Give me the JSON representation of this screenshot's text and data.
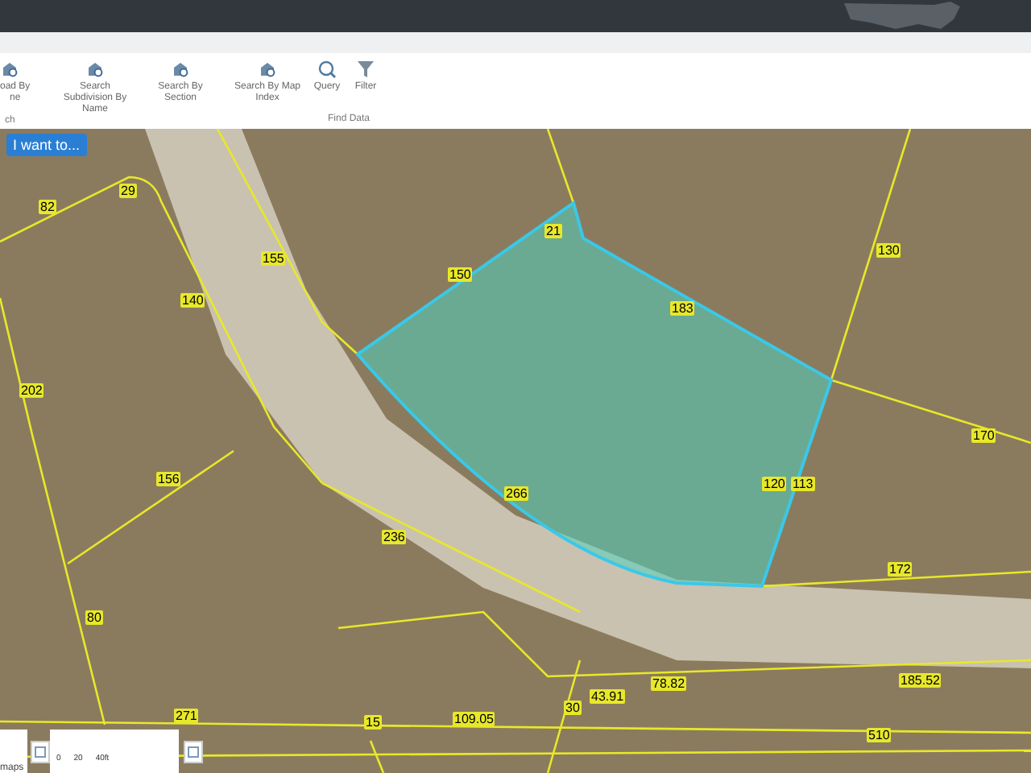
{
  "toolbar": {
    "groups": [
      {
        "label": "ch",
        "items": [
          {
            "kind": "search",
            "lines": [
              "oad By",
              "ne"
            ]
          },
          {
            "kind": "search",
            "lines": [
              "Search",
              "Subdivision By",
              "Name"
            ]
          },
          {
            "kind": "search",
            "lines": [
              "Search By",
              "Section"
            ]
          },
          {
            "kind": "search",
            "lines": [
              "Search By Map",
              "Index"
            ]
          }
        ]
      },
      {
        "label": "Find Data",
        "items": [
          {
            "kind": "query",
            "lines": [
              "Query"
            ]
          },
          {
            "kind": "filter",
            "lines": [
              "Filter"
            ]
          }
        ]
      }
    ]
  },
  "map": {
    "menu_button": "I want to...",
    "labels": [
      "82",
      "29",
      "140",
      "202",
      "155",
      "150",
      "21",
      "183",
      "130",
      "170",
      "120",
      "113",
      "172",
      "266",
      "236",
      "156",
      "80",
      "271",
      "15",
      "109.05",
      "78.82",
      "185.52",
      "510",
      "30",
      "43.91"
    ],
    "maps_button": "maps",
    "scale": {
      "ticks": [
        "0",
        "20",
        "40ft"
      ]
    }
  }
}
